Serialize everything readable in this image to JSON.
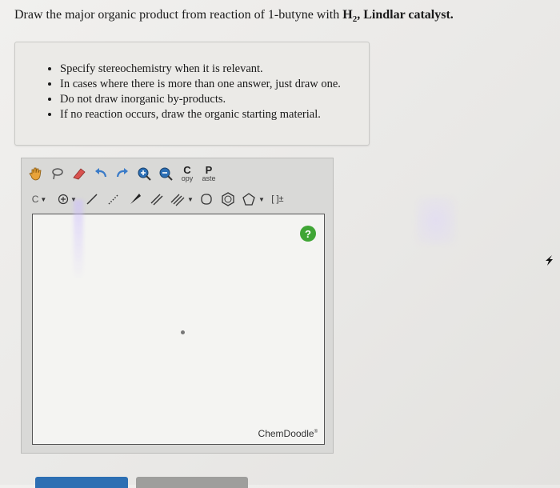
{
  "question": {
    "prefix": "Draw the major organic product from reaction of 1-butyne with ",
    "reagent_h": "H",
    "reagent_sub": "2",
    "reagent_suffix": ", Lindlar catalyst."
  },
  "notes": [
    "Specify stereochemistry when it is relevant.",
    "In cases where there is more than one answer, just draw one.",
    "Do not draw inorganic by-products.",
    "If no reaction occurs, draw the organic starting material."
  ],
  "toolbar": {
    "copy_top": "C",
    "copy_bottom": "opy",
    "paste_top": "P",
    "paste_bottom": "aste",
    "atom_label": "C",
    "bracket_label": "[ ]±"
  },
  "canvas": {
    "help_label": "?",
    "brand": "ChemDoodle",
    "brand_mark": "®"
  },
  "colors": {
    "help_green": "#3fa535",
    "primary_button": "#2d6fb3",
    "secondary_button": "#9e9e9c"
  }
}
